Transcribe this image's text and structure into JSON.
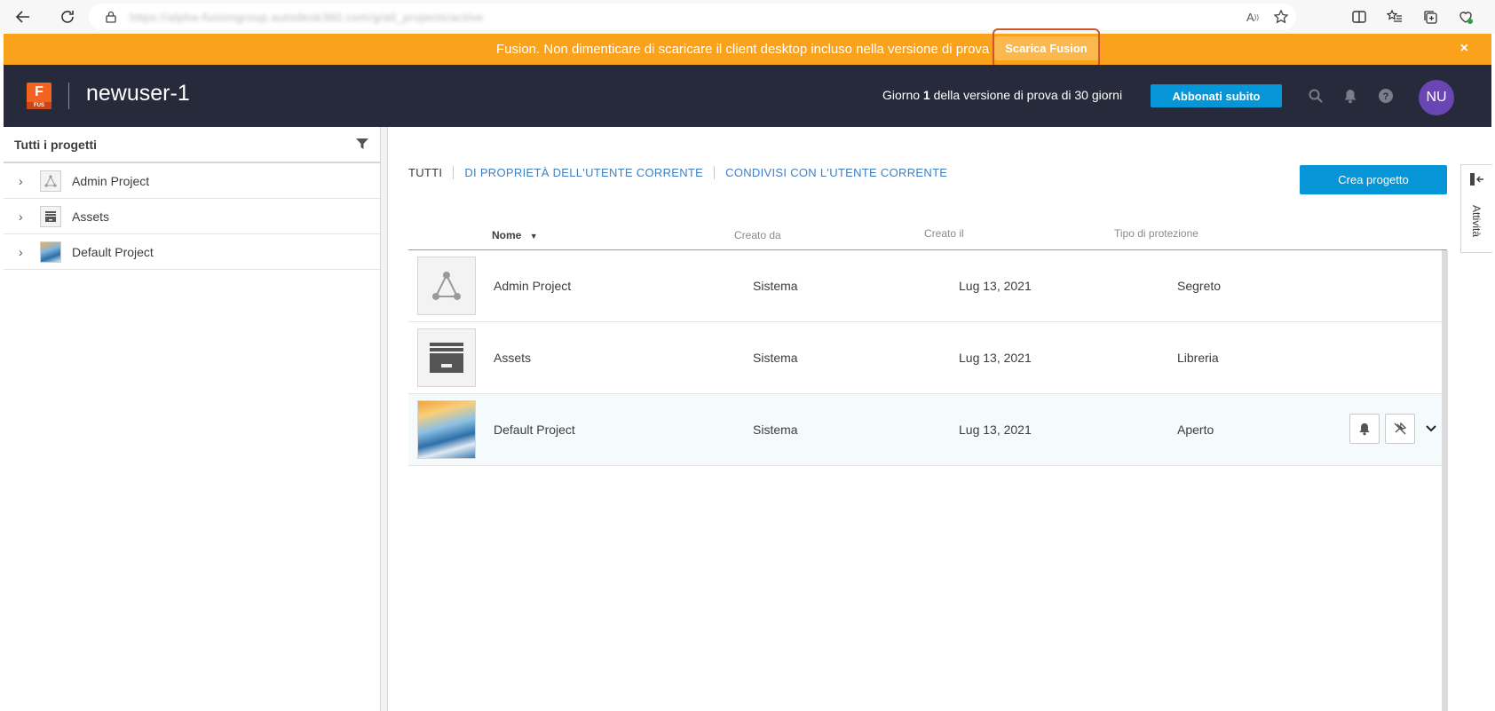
{
  "browser": {
    "url": "https://alpha-fusiongroup.autodesk360.com/g/all_projects/active"
  },
  "banner": {
    "message": "Fusion. Non dimenticare di scaricare il client desktop incluso nella versione di prova di 30 giorni.",
    "button_label": "Scarica Fusion",
    "close_label": "×"
  },
  "header": {
    "logo_letter": "F",
    "logo_sub": "FUS",
    "title": "newuser-1",
    "trial_prefix": "Giorno",
    "trial_day": "1",
    "trial_suffix": "della versione di prova di 30 giorni",
    "subscribe_label": "Abbonati subito",
    "avatar_initials": "NU",
    "avatar_color": "#6a46b5"
  },
  "sidebar": {
    "heading": "Tutti i progetti",
    "items": [
      {
        "label": "Admin Project",
        "icon": "triangle-nodes-icon"
      },
      {
        "label": "Assets",
        "icon": "archive-box-icon"
      },
      {
        "label": "Default Project",
        "icon": "project-image-icon"
      }
    ]
  },
  "tabs": [
    {
      "label": "TUTTI"
    },
    {
      "label": "DI PROPRIETÀ DELL'UTENTE CORRENTE"
    },
    {
      "label": "CONDIVISI CON L'UTENTE CORRENTE"
    }
  ],
  "create_label": "Crea progetto",
  "table": {
    "columns": [
      "Nome",
      "Creato da",
      "Creato il",
      "Tipo di protezione"
    ],
    "rows": [
      {
        "name": "Admin Project",
        "created_by": "Sistema",
        "created_on": "Lug 13, 2021",
        "protection": "Segreto"
      },
      {
        "name": "Assets",
        "created_by": "Sistema",
        "created_on": "Lug 13, 2021",
        "protection": "Libreria"
      },
      {
        "name": "Default Project",
        "created_by": "Sistema",
        "created_on": "Lug 13, 2021",
        "protection": "Aperto"
      }
    ]
  },
  "right_rail": {
    "label": "Attività"
  },
  "colors": {
    "banner": "#faa21b",
    "header": "#272a3a",
    "accent": "#0696d7",
    "link": "#3f7fbf"
  }
}
